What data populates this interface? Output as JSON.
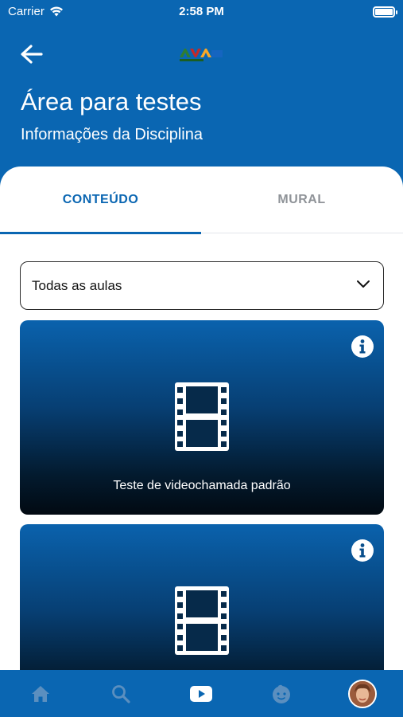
{
  "status_bar": {
    "carrier": "Carrier",
    "time": "2:58 PM"
  },
  "header": {
    "title": "Área para testes",
    "subtitle": "Informações da Disciplina"
  },
  "tabs": [
    {
      "label": "CONTEÚDO",
      "active": true
    },
    {
      "label": "MURAL",
      "active": false
    }
  ],
  "filter": {
    "selected": "Todas as aulas"
  },
  "cards": [
    {
      "title": "Teste de videochamada padrão",
      "icon": "film-icon"
    },
    {
      "title": "",
      "icon": "film-icon"
    }
  ],
  "bottom_nav": [
    "home-icon",
    "search-icon",
    "video-play-icon",
    "child-face-icon",
    "profile-avatar"
  ],
  "colors": {
    "primary": "#0a66b2",
    "tab_inactive": "#8f9398"
  }
}
